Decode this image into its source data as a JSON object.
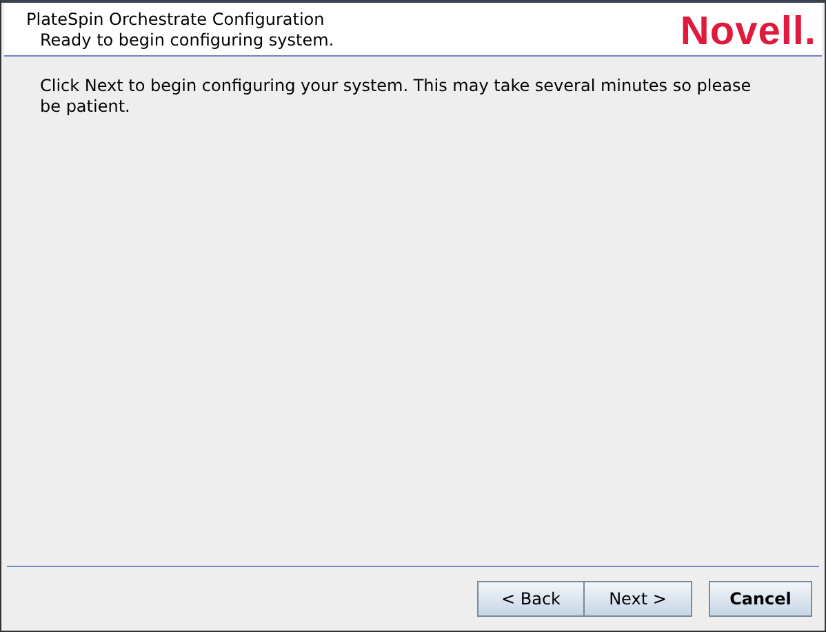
{
  "header": {
    "title": "PlateSpin Orchestrate Configuration",
    "subtitle": "Ready to begin configuring system.",
    "logo": "Novell."
  },
  "message": "Click Next to begin configuring your system.  This may take several minutes so please be patient.",
  "buttons": [
    {
      "label": "< Back",
      "kind": "nav"
    },
    {
      "label": "Next >",
      "kind": "nav"
    },
    {
      "label": "Cancel",
      "kind": "cancel"
    }
  ]
}
